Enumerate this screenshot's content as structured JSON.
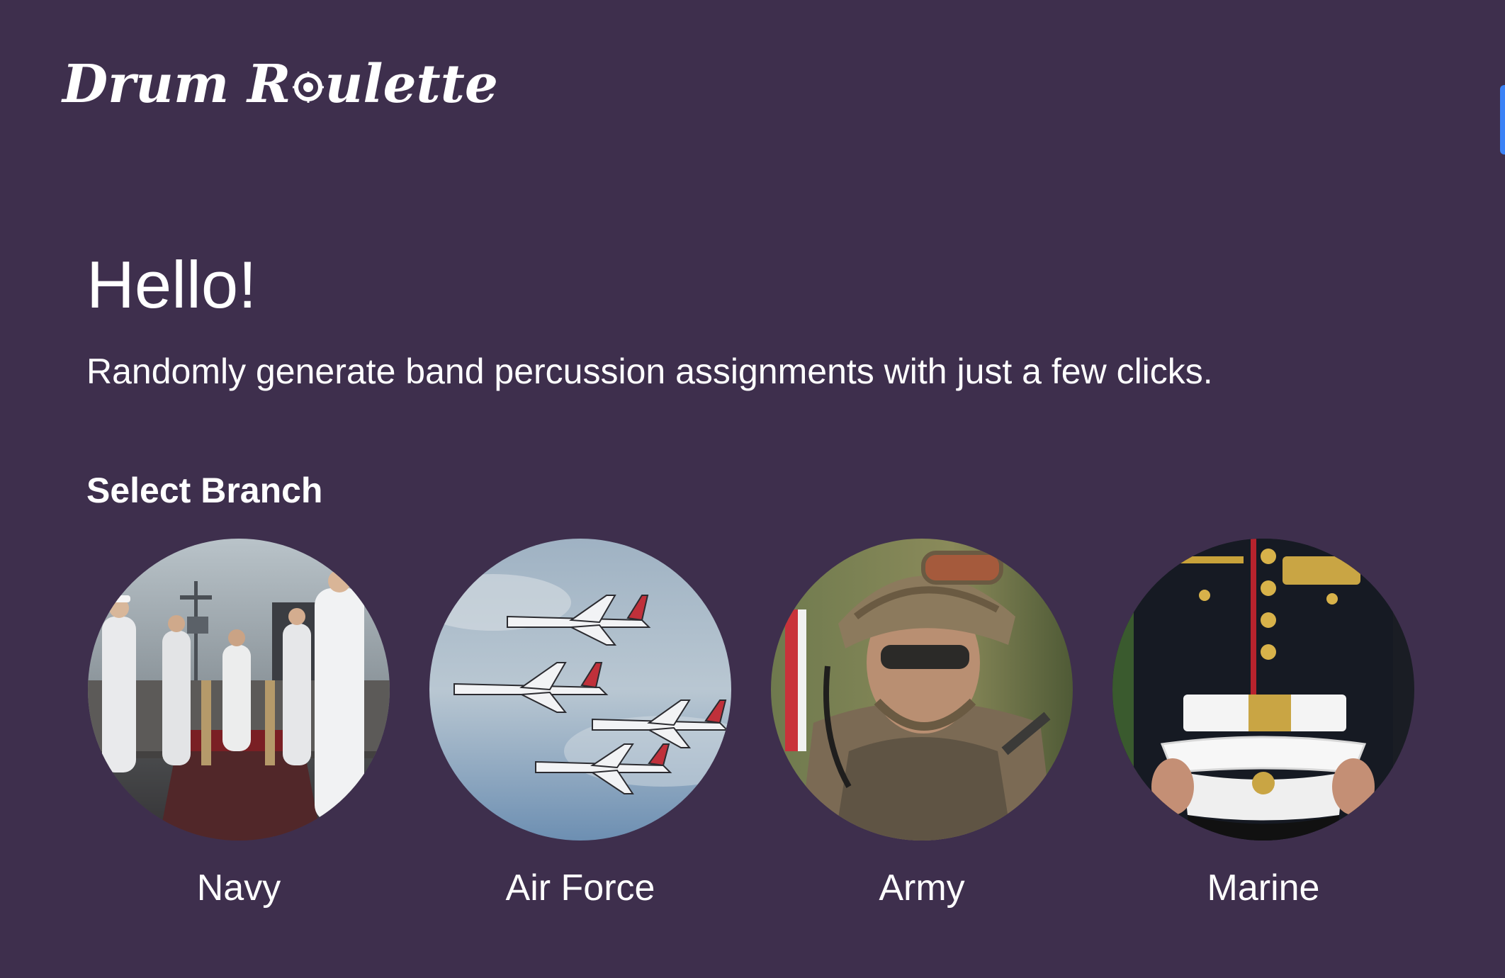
{
  "app": {
    "logo_part1": "Drum R",
    "logo_part2": "ulette"
  },
  "hero": {
    "greeting": "Hello!",
    "subtitle": "Randomly generate band percussion assignments with just a few clicks."
  },
  "branch_section": {
    "label": "Select Branch",
    "branches": [
      {
        "label": "Navy",
        "image_icon": "navy-sailors-saluting-image"
      },
      {
        "label": "Air Force",
        "image_icon": "jets-formation-image"
      },
      {
        "label": "Army",
        "image_icon": "army-soldier-image"
      },
      {
        "label": "Marine",
        "image_icon": "marine-dress-uniform-image"
      }
    ]
  },
  "colors": {
    "background": "#3e2f4d",
    "text": "#ffffff",
    "edge_tab": "#3b82f6"
  }
}
